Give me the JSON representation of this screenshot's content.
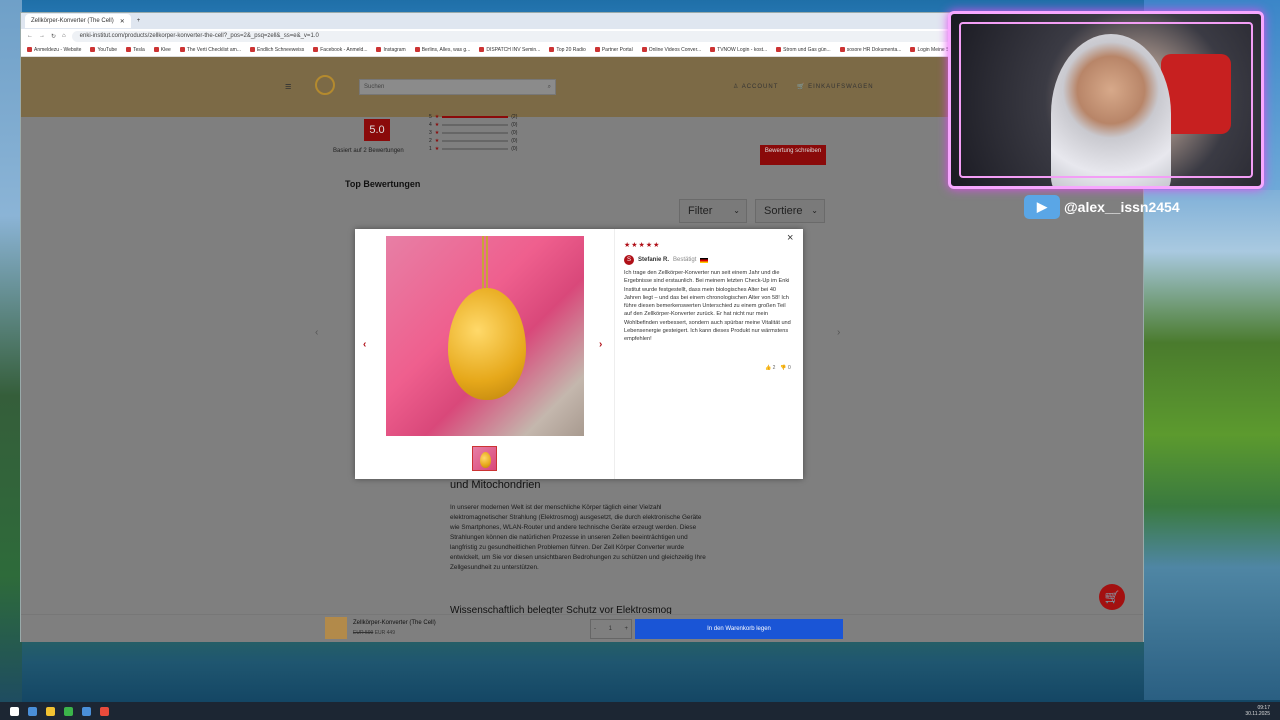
{
  "browser": {
    "tab_title": "Zellkörper-Konverter (The Cell)",
    "address": "enki-institut.com/products/zellkorper-konverter-the-cell?_pos=2&_psq=zell&_ss=e&_v=1.0",
    "bookmarks": [
      "Anmeldezu - Website",
      "YouTube",
      "Tesla",
      "Klee",
      "The Verti Checklist am...",
      "Endlich Schneeweiss",
      "Facebook - Anmeld...",
      "Instagram",
      "Berlins, Alles, was g...",
      "DISPATCH INV Semin...",
      "Top 20 Radio",
      "Partner Portal",
      "Online Videos Conver...",
      "TVNOW Login - kost...",
      "Strom und Gas gün...",
      "sosore HR Dokumenta...",
      "Login Meine Sparb..."
    ]
  },
  "site": {
    "search_placeholder": "Suchen",
    "account_label": "ACCOUNT",
    "cart_label": "EINKAUFSWAGEN"
  },
  "reviews": {
    "score": "5.0",
    "based_on": "Basiert auf 2 Bewertungen",
    "write_review": "Bewertung schreiben",
    "top_title": "Top Bewertungen",
    "filter_label": "Filter",
    "sort_label": "Sortiere",
    "rating_rows": [
      {
        "stars": "5",
        "count": "(2)"
      },
      {
        "stars": "4",
        "count": "(0)"
      },
      {
        "stars": "3",
        "count": "(0)"
      },
      {
        "stars": "2",
        "count": "(0)"
      },
      {
        "stars": "1",
        "count": "(0)"
      }
    ]
  },
  "modal": {
    "stars": "★★★★★",
    "author": "Stefanie R.",
    "avatar_letter": "S",
    "verified": "Bestätigt",
    "text": "Ich trage den Zellkörper-Konverter nun seit einem Jahr und die Ergebnisse sind erstaunlich. Bei meinem letzten Check-Up im Enki Institut wurde festgestellt, dass mein biologisches Alter bei 40 Jahren liegt – und das bei einem chronologischen Alter von 58! Ich führe diesen bemerkenswerten Unterschied zu einem großen Teil auf den Zellkörper-Konverter zurück. Er hat nicht nur mein Wohlbefinden verbessert, sondern auch spürbar meine Vitalität und Lebensenergie gesteigert. Ich kann dieses Produkt nur wärmstens empfehlen!",
    "likes": "2",
    "dislikes": "0"
  },
  "content": {
    "heading": "und Mitochondrien",
    "paragraph": "In unserer modernen Welt ist der menschliche Körper täglich einer Vielzahl elektromagnetischer Strahlung (Elektrosmog) ausgesetzt, die durch elektronische Geräte wie Smartphones, WLAN-Router und andere technische Geräte erzeugt werden. Diese Strahlungen können die natürlichen Prozesse in unseren Zellen beeinträchtigen und langfristig zu gesundheitlichen Problemen führen. Der Zell Körper Converter wurde entwickelt, um Sie vor diesen unsichtbaren Bedrohungen zu schützen und gleichzeitig Ihre Zellgesundheit zu unterstützen.",
    "next_heading": "Wissenschaftlich belegter Schutz vor Elektrosmog"
  },
  "sticky": {
    "product": "Zellkörper-Konverter (The Cell)",
    "old_price": "EUR 599",
    "price": "EUR 449",
    "qty": "1",
    "cart_button": "In den Warenkorb legen"
  },
  "stream": {
    "handle": "@alex__issn2454"
  },
  "clock": {
    "time": "09:17",
    "date": "30.11.2025"
  }
}
